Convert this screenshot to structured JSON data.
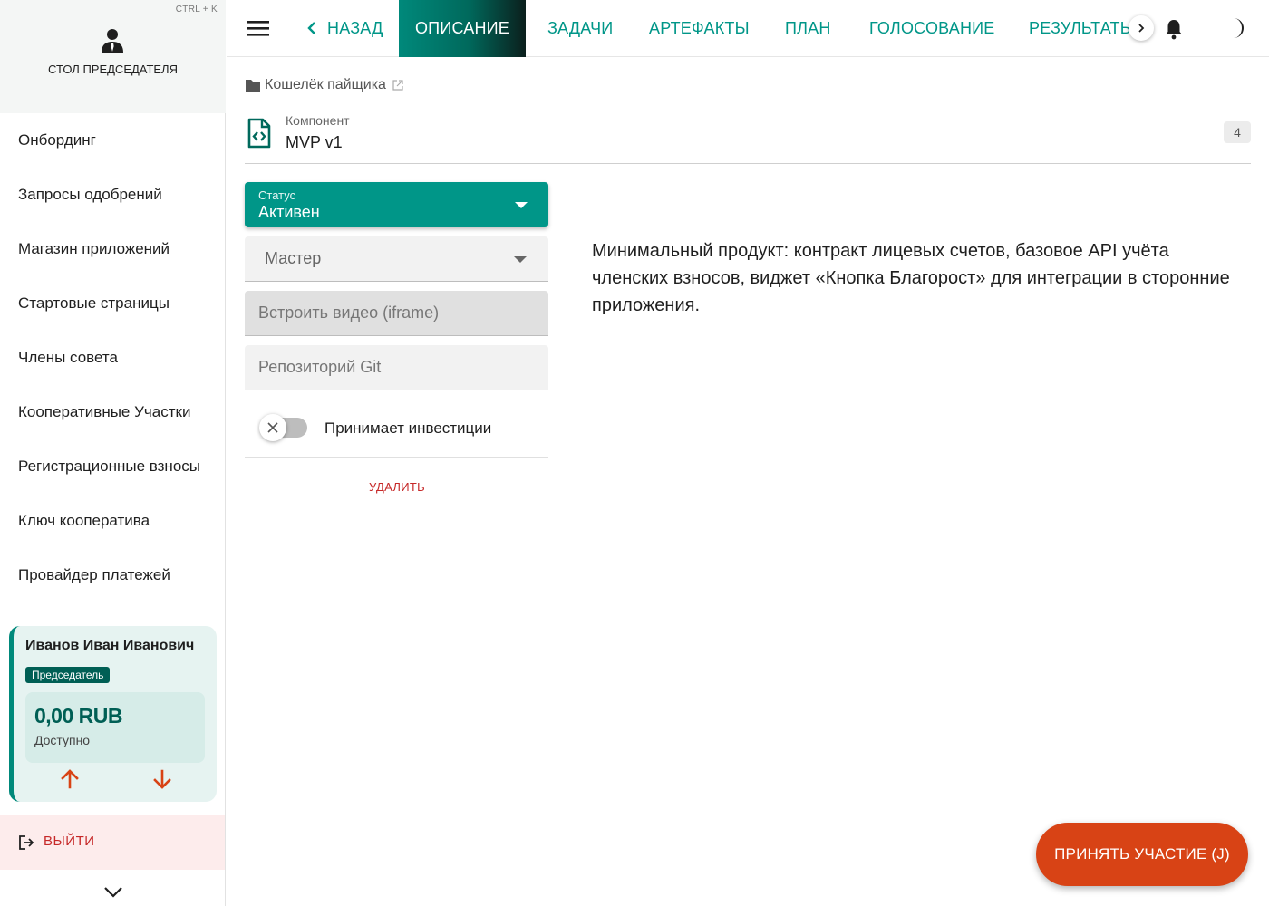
{
  "sidebar": {
    "shortcut": "CTRL + K",
    "title": "СТОЛ ПРЕДСЕДАТЕЛЯ",
    "menu": [
      {
        "label": "Онбординг"
      },
      {
        "label": "Запросы одобрений"
      },
      {
        "label": "Магазин приложений"
      },
      {
        "label": "Стартовые страницы"
      },
      {
        "label": "Члены совета"
      },
      {
        "label": "Кооперативные Участки"
      },
      {
        "label": "Регистрационные взносы"
      },
      {
        "label": "Ключ кооператива"
      },
      {
        "label": "Провайдер платежей"
      }
    ],
    "user": {
      "name": "Иванов Иван Иванович",
      "role": "Председатель",
      "balance": "0,00 RUB",
      "balance_caption": "Доступно"
    },
    "logout_label": "ВЫЙТИ"
  },
  "topbar": {
    "back_label": "НАЗАД",
    "tabs": [
      {
        "label": "ОПИСАНИЕ",
        "active": true
      },
      {
        "label": "ЗАДАЧИ"
      },
      {
        "label": "АРТЕФАКТЫ"
      },
      {
        "label": "ПЛАН"
      },
      {
        "label": "ГОЛОСОВАНИЕ"
      },
      {
        "label": "РЕЗУЛЬТАТЫ"
      }
    ]
  },
  "breadcrumb": {
    "label": "Кошелёк пайщика"
  },
  "component": {
    "type": "Компонент",
    "name": "MVP v1",
    "badge": "4"
  },
  "form": {
    "status_label": "Статус",
    "status_value": "Активен",
    "master_placeholder": "Мастер",
    "iframe_placeholder": "Встроить видео (iframe)",
    "git_placeholder": "Репозиторий Git",
    "investments_label": "Принимает инвестиции",
    "investments_enabled": false,
    "delete_label": "УДАЛИТЬ"
  },
  "description": "Минимальный продукт: контракт лицевых счетов, базовое API учёта членских взносов, виджет «Кнопка Благорост» для интеграции в сторонние приложения.",
  "fab": {
    "label": "ПРИНЯТЬ УЧАСТИЕ (J)"
  },
  "colors": {
    "accent": "#009688",
    "danger": "#c62828",
    "fab": "#d84315",
    "card": "#e6f3f1"
  }
}
